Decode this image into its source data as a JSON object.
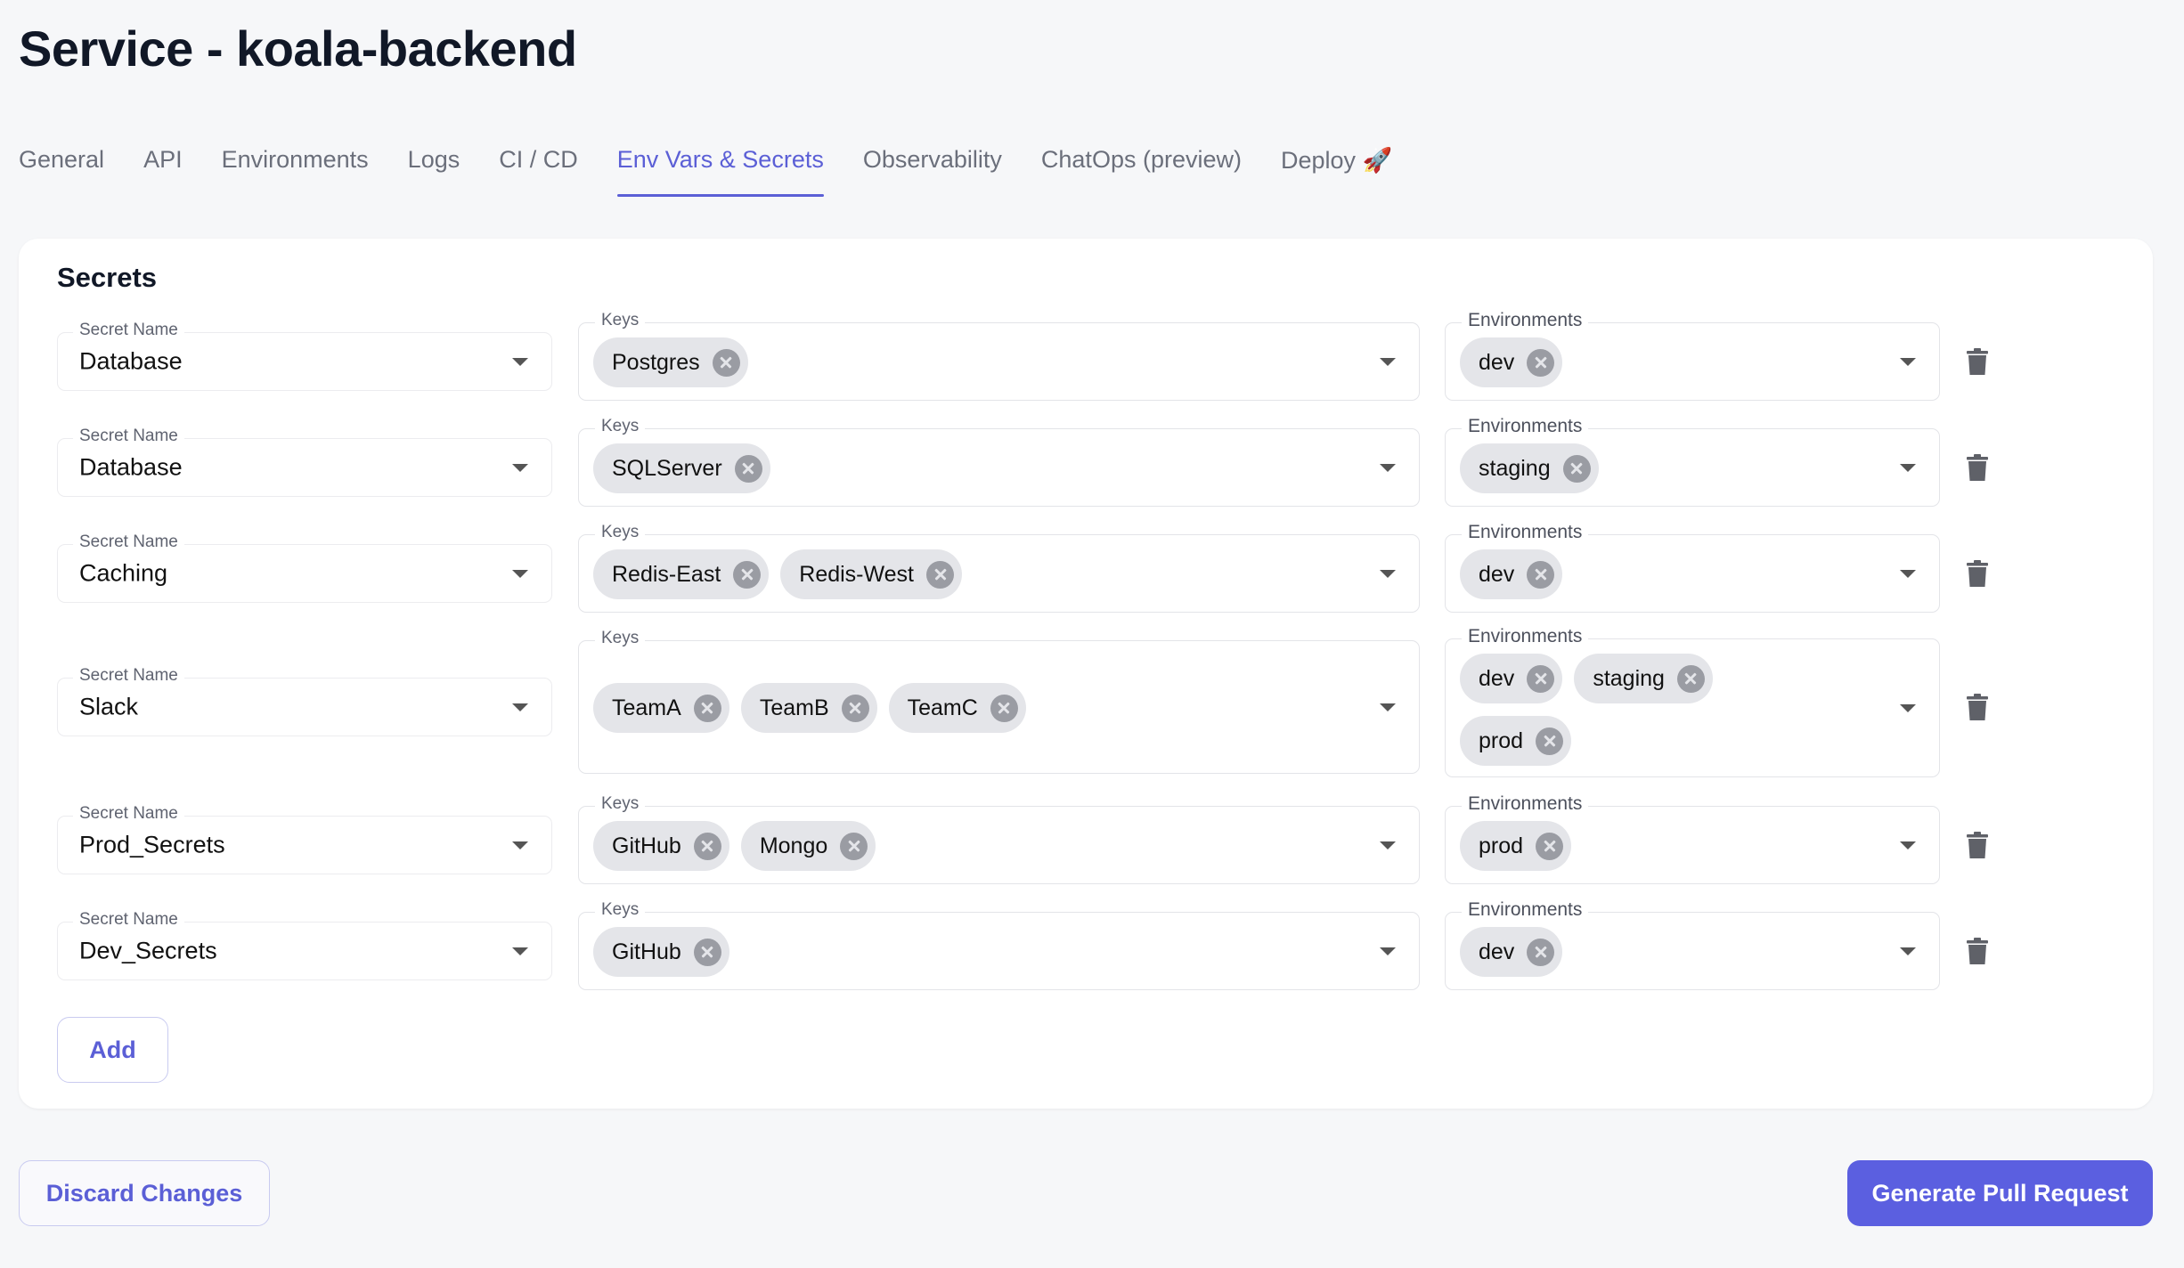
{
  "page": {
    "title": "Service - koala-backend"
  },
  "tabs": [
    {
      "label": "General"
    },
    {
      "label": "API"
    },
    {
      "label": "Environments"
    },
    {
      "label": "Logs"
    },
    {
      "label": "CI / CD"
    },
    {
      "label": "Env Vars & Secrets",
      "active": true
    },
    {
      "label": "Observability"
    },
    {
      "label": "ChatOps (preview)"
    },
    {
      "label": "Deploy 🚀"
    }
  ],
  "secrets_card": {
    "title": "Secrets",
    "labels": {
      "secret_name": "Secret Name",
      "keys": "Keys",
      "environments": "Environments"
    },
    "rows": [
      {
        "name": "Database",
        "keys": [
          "Postgres"
        ],
        "environments": [
          "dev"
        ]
      },
      {
        "name": "Database",
        "keys": [
          "SQLServer"
        ],
        "environments": [
          "staging"
        ]
      },
      {
        "name": "Caching",
        "keys": [
          "Redis-East",
          "Redis-West"
        ],
        "environments": [
          "dev"
        ]
      },
      {
        "name": "Slack",
        "keys": [
          "TeamA",
          "TeamB",
          "TeamC"
        ],
        "environments": [
          "dev",
          "staging",
          "prod"
        ]
      },
      {
        "name": "Prod_Secrets",
        "keys": [
          "GitHub",
          "Mongo"
        ],
        "environments": [
          "prod"
        ]
      },
      {
        "name": "Dev_Secrets",
        "keys": [
          "GitHub"
        ],
        "environments": [
          "dev"
        ]
      }
    ],
    "add_label": "Add"
  },
  "footer": {
    "discard_label": "Discard Changes",
    "generate_label": "Generate Pull Request"
  },
  "colors": {
    "accent": "#5b5fd6",
    "background": "#f6f7f9",
    "chip": "#e4e5e9"
  },
  "icons": {
    "remove_chip": "close-circle-icon",
    "dropdown": "chevron-down-icon",
    "delete_row": "trash-icon"
  }
}
